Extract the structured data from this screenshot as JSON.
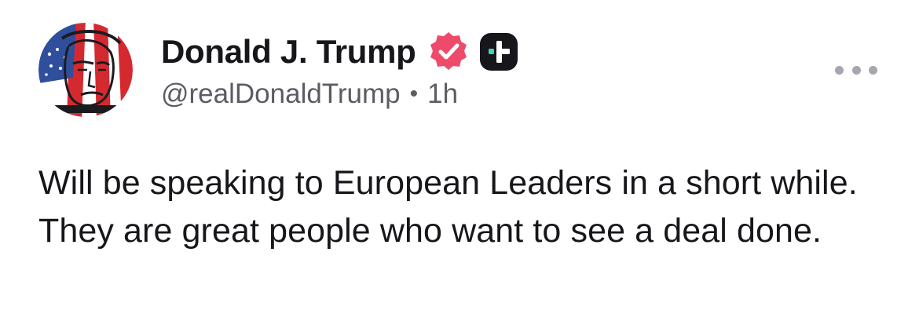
{
  "post": {
    "author": {
      "display_name": "Donald J. Trump",
      "handle": "@realDonaldTrump",
      "avatar_icon": "flag-portrait-avatar",
      "verified_icon": "verified-badge-icon",
      "verified_color": "#ee4b6b",
      "subscription_icon": "plus-badge-icon"
    },
    "separator": "•",
    "timestamp": "1h",
    "menu_icon": "more-options-icon",
    "text": "Will be speaking to European Leaders in a short while. They are great people who want to see a deal done."
  }
}
